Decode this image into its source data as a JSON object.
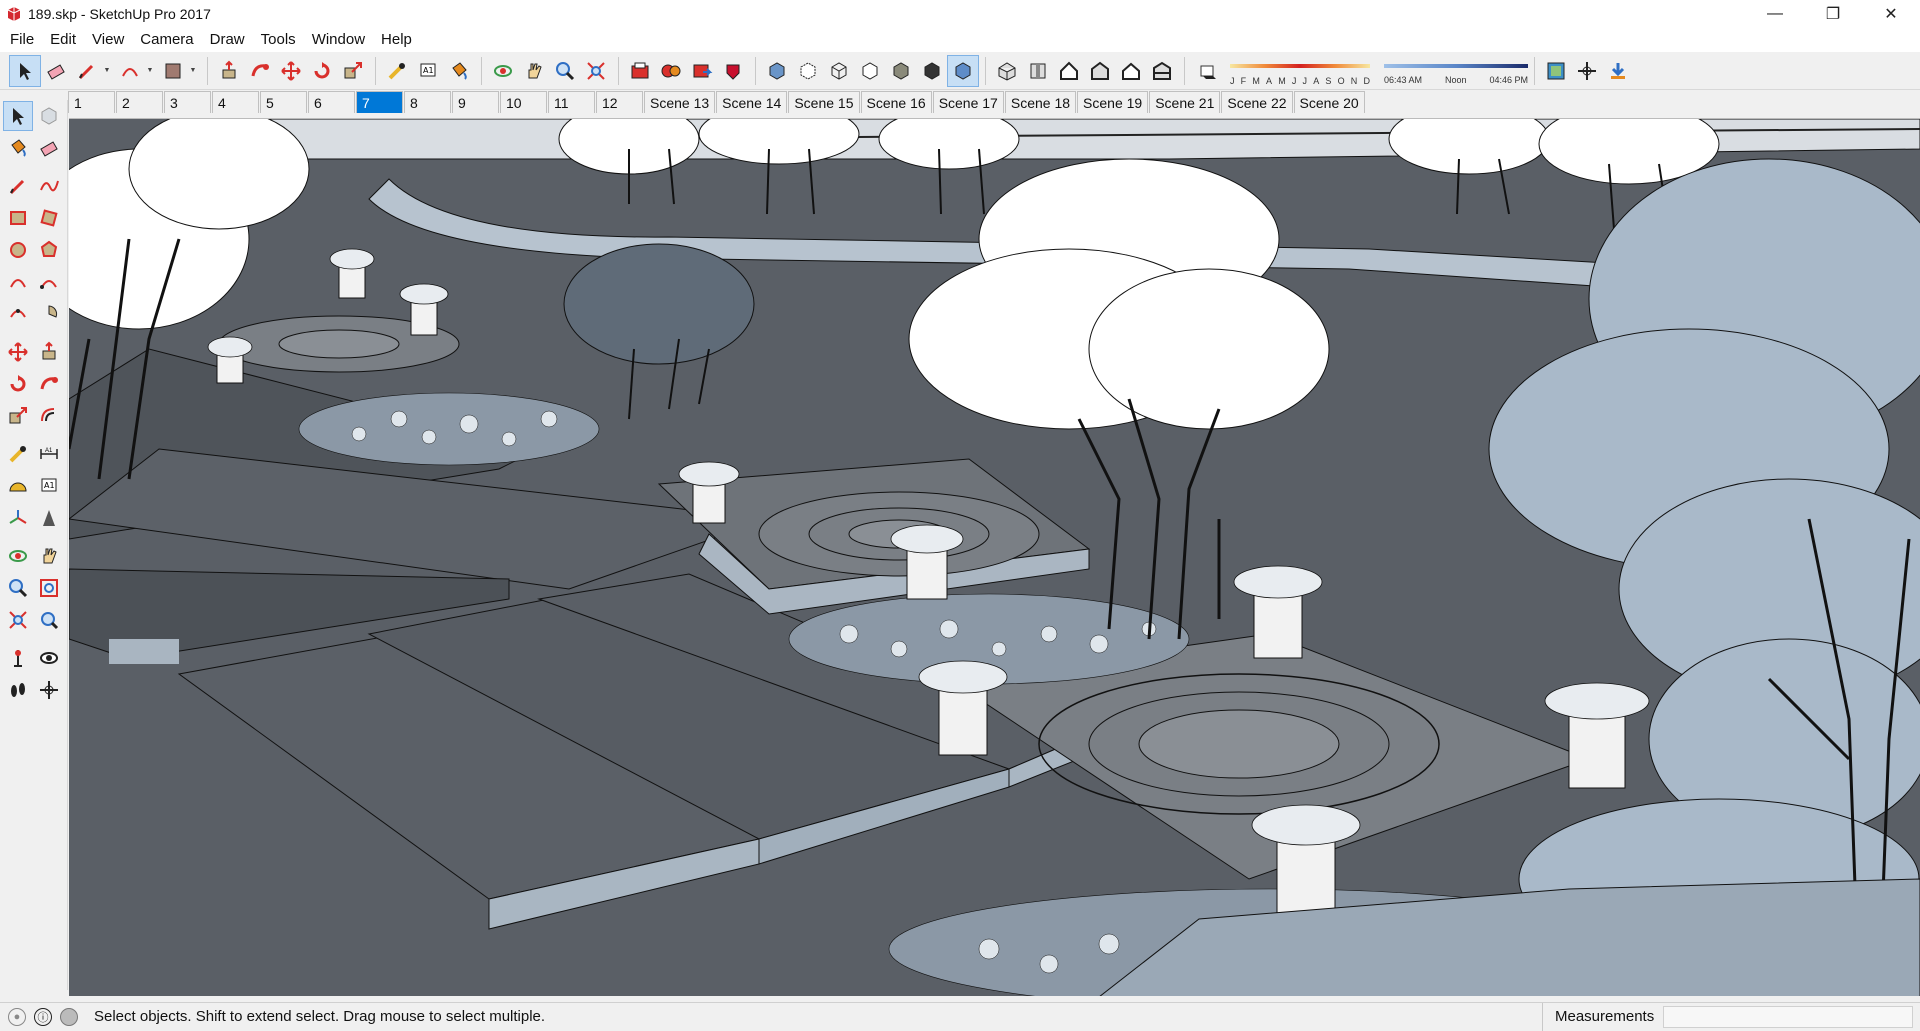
{
  "window": {
    "title": "189.skp - SketchUp Pro 2017",
    "minimize": "—",
    "restore": "❐",
    "close": "✕"
  },
  "menu": [
    "File",
    "Edit",
    "View",
    "Camera",
    "Draw",
    "Tools",
    "Window",
    "Help"
  ],
  "toolbar": {
    "icons": [
      "select-icon",
      "eraser-icon",
      "pencil-line-icon",
      "arc-icon",
      "shapes-icon",
      "push-pull-icon",
      "follow-me-icon",
      "move-icon",
      "rotate-icon",
      "scale-icon",
      "tape-measure-icon",
      "text-icon",
      "paint-bucket-icon",
      "orbit-icon",
      "pan-icon",
      "zoom-icon",
      "zoom-extents-icon",
      "get-models-icon",
      "components-icon",
      "share-model-icon",
      "extension-warehouse-icon",
      "xray-icon",
      "back-edges-icon",
      "wireframe-icon",
      "hidden-line-icon",
      "shaded-icon",
      "textured-icon",
      "monochrome-icon",
      "iso-view-icon",
      "top-view-icon",
      "front-view-icon",
      "right-view-icon",
      "back-view-icon",
      "left-view-icon",
      "shadows-toggle-icon"
    ],
    "months": [
      "J",
      "F",
      "M",
      "A",
      "M",
      "J",
      "J",
      "A",
      "S",
      "O",
      "N",
      "D"
    ],
    "time_start": "06:43 AM",
    "time_noon": "Noon",
    "time_end": "04:46 PM",
    "trailing_icons": [
      "layer-manager-icon",
      "section-plane-icon",
      "download-icon"
    ]
  },
  "scenes": {
    "tabs": [
      "1",
      "2",
      "3",
      "4",
      "5",
      "6",
      "7",
      "8",
      "9",
      "10",
      "11",
      "12",
      "Scene 13",
      "Scene 14",
      "Scene 15",
      "Scene 16",
      "Scene 17",
      "Scene 18",
      "Scene 19",
      "Scene 21",
      "Scene 22",
      "Scene 20"
    ],
    "active_index": 6
  },
  "palette": {
    "rows": [
      [
        "select-icon",
        "component-icon"
      ],
      [
        "paint-bucket-icon",
        "eraser-icon"
      ],
      [
        "pencil-line-icon",
        "freehand-icon"
      ],
      [
        "rectangle-icon",
        "rotated-rectangle-icon"
      ],
      [
        "circle-icon",
        "polygon-icon"
      ],
      [
        "arc-icon",
        "two-point-arc-icon"
      ],
      [
        "three-point-arc-icon",
        "pie-icon"
      ],
      [
        "move-icon",
        "push-pull-icon"
      ],
      [
        "rotate-icon",
        "follow-me-icon"
      ],
      [
        "scale-icon",
        "offset-icon"
      ],
      [
        "tape-measure-icon",
        "dimension-icon"
      ],
      [
        "protractor-icon",
        "text-icon"
      ],
      [
        "axes-icon",
        "3d-text-icon"
      ],
      [
        "orbit-icon",
        "pan-icon"
      ],
      [
        "zoom-icon",
        "zoom-window-icon"
      ],
      [
        "zoom-extents-icon",
        "previous-view-icon"
      ],
      [
        "position-camera-icon",
        "look-around-icon"
      ],
      [
        "walk-icon",
        "section-plane-icon"
      ]
    ]
  },
  "status": {
    "message": "Select objects. Shift to extend select. Drag mouse to select multiple.",
    "measurements_label": "Measurements",
    "measurements_value": ""
  },
  "colors": {
    "active_tab": "#0078d7",
    "ground": "#5a5f66",
    "foliage_light": "#a9b9c9",
    "sky": "#ffffff"
  }
}
